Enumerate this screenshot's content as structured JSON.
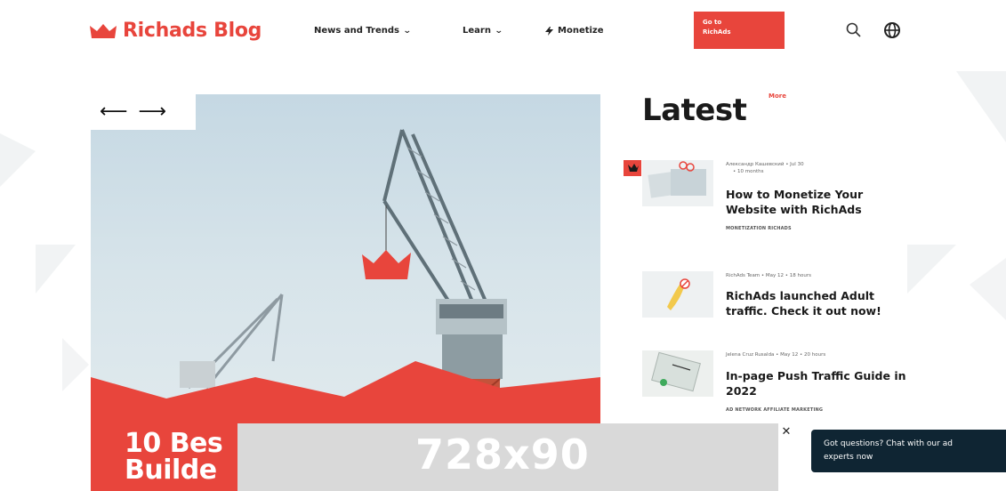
{
  "header": {
    "logo_text": "Richads Blog",
    "nav": [
      {
        "label": "News and Trends",
        "has_dropdown": true
      },
      {
        "label": "Learn",
        "has_dropdown": true
      },
      {
        "label": "Monetize",
        "has_dropdown": false
      }
    ],
    "cta_line1": "Go to",
    "cta_line2": "RichAds"
  },
  "hero": {
    "title_line1": "10 Bes",
    "title_line2": "Builde"
  },
  "latest": {
    "title": "Latest",
    "more_label": "More",
    "posts": [
      {
        "meta_line1": "Александр Кашевский • Jul 30",
        "meta_line2": "• 10 months",
        "title": "How to Monetize Your Website with RichAds",
        "tags": "MONETIZATION  RICHADS"
      },
      {
        "meta_line1": "RichAds Team • May 12 • 18 hours",
        "meta_line2": "",
        "title": "RichAds launched Adult traffic. Check it out now!",
        "tags": ""
      },
      {
        "meta_line1": "Jelena Cruz Rusalda • May 12 • 20 hours",
        "meta_line2": "",
        "title": "In-page Push Traffic Guide in 2022",
        "tags": "AD NETWORK  AFFILIATE MARKETING"
      }
    ]
  },
  "ad": {
    "label": "728x90",
    "close_symbol": "✕"
  },
  "chat": {
    "line1": "Got questions? Chat with our ad",
    "line2": "experts now"
  },
  "colors": {
    "brand": "#e8453c",
    "chat_bg": "#0f2533"
  }
}
